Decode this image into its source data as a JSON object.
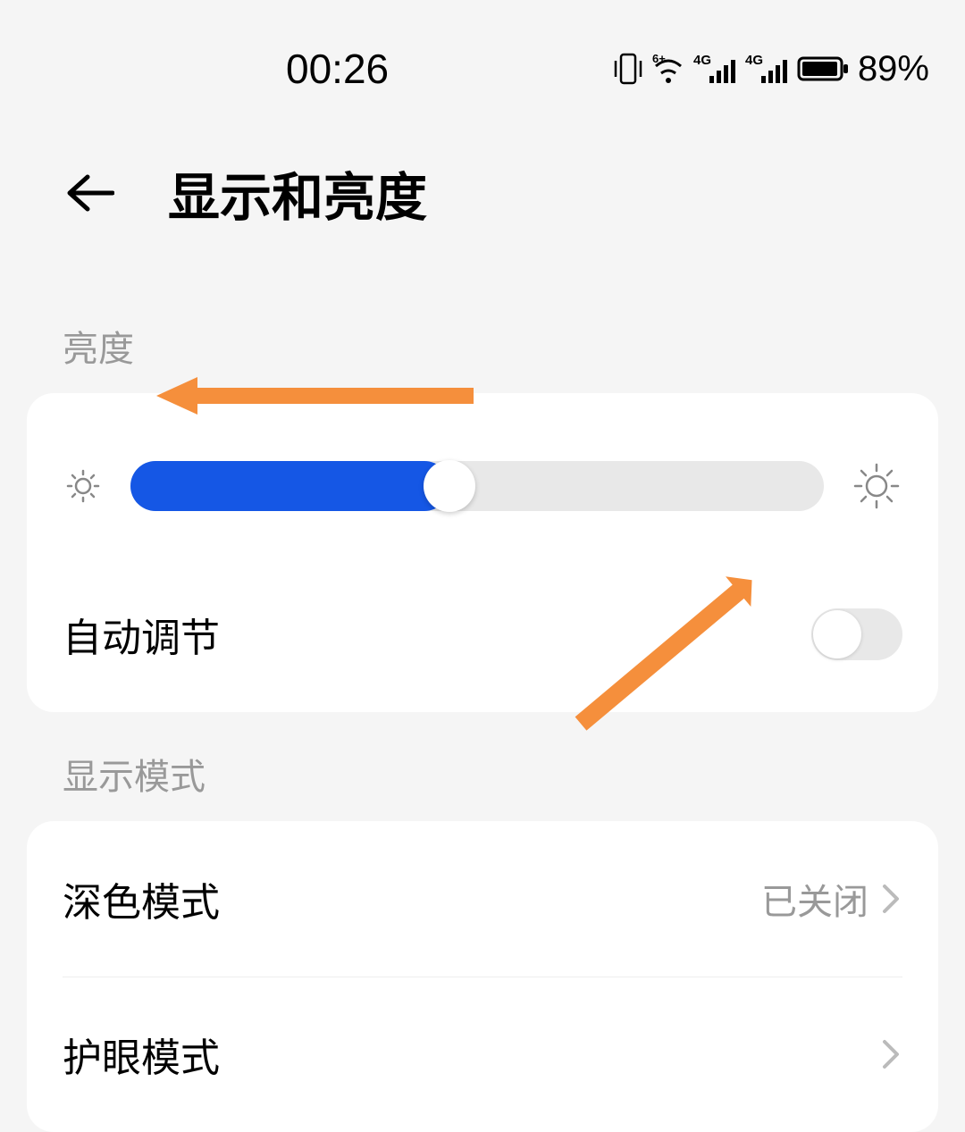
{
  "status": {
    "time": "00:26",
    "battery_percent": "89%"
  },
  "header": {
    "title": "显示和亮度"
  },
  "sections": {
    "brightness": {
      "label": "亮度",
      "slider_percent": 46,
      "auto_adjust_label": "自动调节",
      "auto_adjust_on": false
    },
    "display_mode": {
      "label": "显示模式",
      "dark_mode_label": "深色模式",
      "dark_mode_value": "已关闭",
      "eye_protection_label": "护眼模式"
    }
  }
}
